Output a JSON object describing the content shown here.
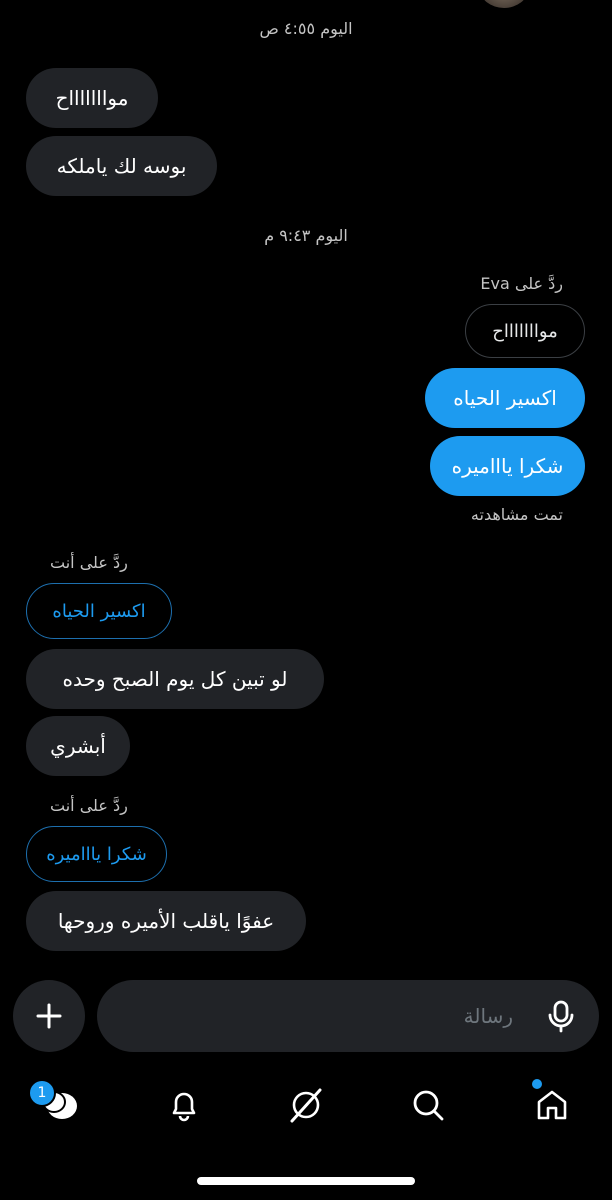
{
  "conversation": {
    "timestamps": {
      "first": "اليوم ٤:٥٥ ص",
      "second": "اليوم ٩:٤٣ م"
    },
    "messages": {
      "m1": "مواااااااح",
      "m2": "بوسه لك ياملكه",
      "reply_label_out": "ردَّ على Eva",
      "quote_out": "مواااااااح",
      "m3": "اكسير الحياه",
      "m4": "شكرا ياااميره",
      "seen_status": "تمت مشاهدته",
      "reply_label_in_1": "ردَّ على أنت",
      "quote_in_1": "اكسير الحياه",
      "m5": "لو تبين كل يوم الصبح وحده",
      "m6": "أبشري",
      "reply_label_in_2": "ردَّ على أنت",
      "quote_in_2": "شكرا ياااميره",
      "m7": "عفوًا ياقلب الأميره وروحها"
    }
  },
  "composer": {
    "placeholder": "رسالة",
    "add_icon": "plus-icon",
    "mic_icon": "microphone-icon"
  },
  "bottom_nav": {
    "messages_badge": "1",
    "icons": [
      "messages-icon",
      "bell-icon",
      "grok-icon",
      "search-icon",
      "home-icon"
    ]
  },
  "colors": {
    "accent": "#1d9bf0",
    "incoming_bubble": "#212327",
    "background": "#000000"
  }
}
